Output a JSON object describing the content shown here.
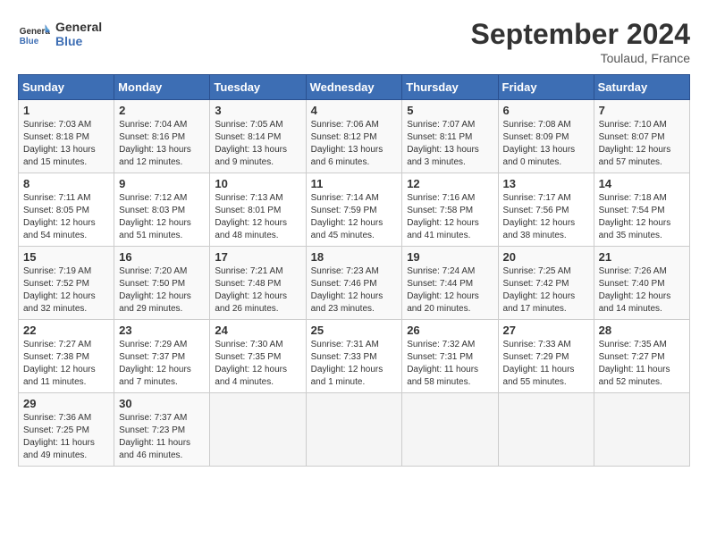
{
  "header": {
    "logo_line1": "General",
    "logo_line2": "Blue",
    "month": "September 2024",
    "location": "Toulaud, France"
  },
  "weekdays": [
    "Sunday",
    "Monday",
    "Tuesday",
    "Wednesday",
    "Thursday",
    "Friday",
    "Saturday"
  ],
  "weeks": [
    [
      {
        "day": 1,
        "info": "Sunrise: 7:03 AM\nSunset: 8:18 PM\nDaylight: 13 hours\nand 15 minutes."
      },
      {
        "day": 2,
        "info": "Sunrise: 7:04 AM\nSunset: 8:16 PM\nDaylight: 13 hours\nand 12 minutes."
      },
      {
        "day": 3,
        "info": "Sunrise: 7:05 AM\nSunset: 8:14 PM\nDaylight: 13 hours\nand 9 minutes."
      },
      {
        "day": 4,
        "info": "Sunrise: 7:06 AM\nSunset: 8:12 PM\nDaylight: 13 hours\nand 6 minutes."
      },
      {
        "day": 5,
        "info": "Sunrise: 7:07 AM\nSunset: 8:11 PM\nDaylight: 13 hours\nand 3 minutes."
      },
      {
        "day": 6,
        "info": "Sunrise: 7:08 AM\nSunset: 8:09 PM\nDaylight: 13 hours\nand 0 minutes."
      },
      {
        "day": 7,
        "info": "Sunrise: 7:10 AM\nSunset: 8:07 PM\nDaylight: 12 hours\nand 57 minutes."
      }
    ],
    [
      {
        "day": 8,
        "info": "Sunrise: 7:11 AM\nSunset: 8:05 PM\nDaylight: 12 hours\nand 54 minutes."
      },
      {
        "day": 9,
        "info": "Sunrise: 7:12 AM\nSunset: 8:03 PM\nDaylight: 12 hours\nand 51 minutes."
      },
      {
        "day": 10,
        "info": "Sunrise: 7:13 AM\nSunset: 8:01 PM\nDaylight: 12 hours\nand 48 minutes."
      },
      {
        "day": 11,
        "info": "Sunrise: 7:14 AM\nSunset: 7:59 PM\nDaylight: 12 hours\nand 45 minutes."
      },
      {
        "day": 12,
        "info": "Sunrise: 7:16 AM\nSunset: 7:58 PM\nDaylight: 12 hours\nand 41 minutes."
      },
      {
        "day": 13,
        "info": "Sunrise: 7:17 AM\nSunset: 7:56 PM\nDaylight: 12 hours\nand 38 minutes."
      },
      {
        "day": 14,
        "info": "Sunrise: 7:18 AM\nSunset: 7:54 PM\nDaylight: 12 hours\nand 35 minutes."
      }
    ],
    [
      {
        "day": 15,
        "info": "Sunrise: 7:19 AM\nSunset: 7:52 PM\nDaylight: 12 hours\nand 32 minutes."
      },
      {
        "day": 16,
        "info": "Sunrise: 7:20 AM\nSunset: 7:50 PM\nDaylight: 12 hours\nand 29 minutes."
      },
      {
        "day": 17,
        "info": "Sunrise: 7:21 AM\nSunset: 7:48 PM\nDaylight: 12 hours\nand 26 minutes."
      },
      {
        "day": 18,
        "info": "Sunrise: 7:23 AM\nSunset: 7:46 PM\nDaylight: 12 hours\nand 23 minutes."
      },
      {
        "day": 19,
        "info": "Sunrise: 7:24 AM\nSunset: 7:44 PM\nDaylight: 12 hours\nand 20 minutes."
      },
      {
        "day": 20,
        "info": "Sunrise: 7:25 AM\nSunset: 7:42 PM\nDaylight: 12 hours\nand 17 minutes."
      },
      {
        "day": 21,
        "info": "Sunrise: 7:26 AM\nSunset: 7:40 PM\nDaylight: 12 hours\nand 14 minutes."
      }
    ],
    [
      {
        "day": 22,
        "info": "Sunrise: 7:27 AM\nSunset: 7:38 PM\nDaylight: 12 hours\nand 11 minutes."
      },
      {
        "day": 23,
        "info": "Sunrise: 7:29 AM\nSunset: 7:37 PM\nDaylight: 12 hours\nand 7 minutes."
      },
      {
        "day": 24,
        "info": "Sunrise: 7:30 AM\nSunset: 7:35 PM\nDaylight: 12 hours\nand 4 minutes."
      },
      {
        "day": 25,
        "info": "Sunrise: 7:31 AM\nSunset: 7:33 PM\nDaylight: 12 hours\nand 1 minute."
      },
      {
        "day": 26,
        "info": "Sunrise: 7:32 AM\nSunset: 7:31 PM\nDaylight: 11 hours\nand 58 minutes."
      },
      {
        "day": 27,
        "info": "Sunrise: 7:33 AM\nSunset: 7:29 PM\nDaylight: 11 hours\nand 55 minutes."
      },
      {
        "day": 28,
        "info": "Sunrise: 7:35 AM\nSunset: 7:27 PM\nDaylight: 11 hours\nand 52 minutes."
      }
    ],
    [
      {
        "day": 29,
        "info": "Sunrise: 7:36 AM\nSunset: 7:25 PM\nDaylight: 11 hours\nand 49 minutes."
      },
      {
        "day": 30,
        "info": "Sunrise: 7:37 AM\nSunset: 7:23 PM\nDaylight: 11 hours\nand 46 minutes."
      },
      null,
      null,
      null,
      null,
      null
    ]
  ]
}
